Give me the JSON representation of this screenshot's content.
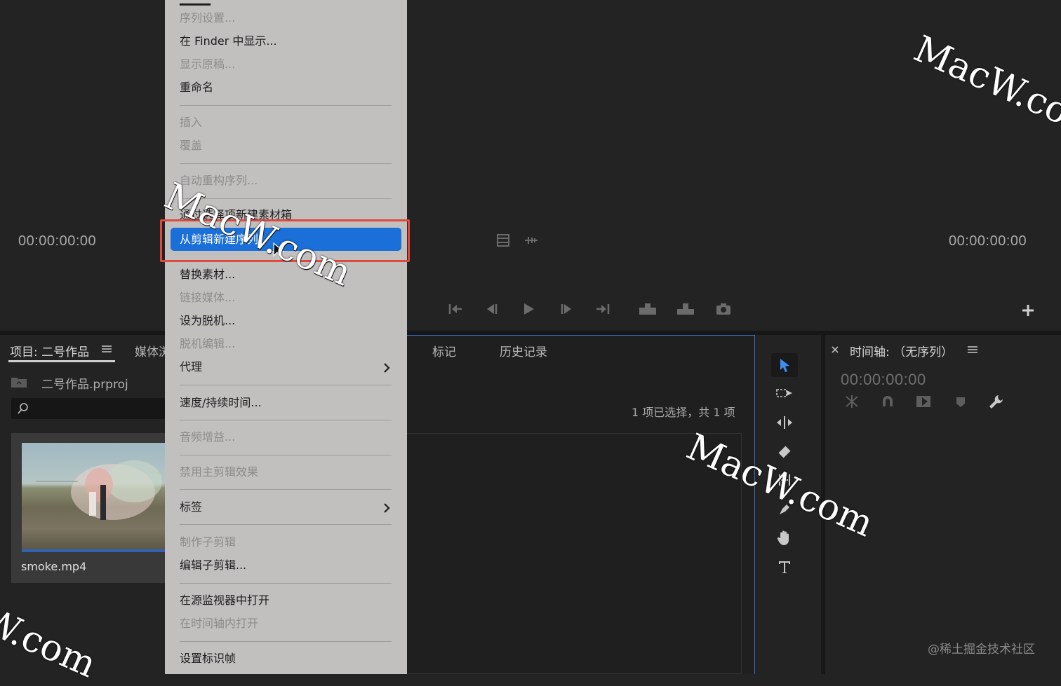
{
  "monitor": {
    "source_timecode": "00:00:00:00",
    "program_timecode": "00:00:00:00"
  },
  "project_panel": {
    "tab_project": "项目: 二号作品",
    "tab_media": "媒体浏",
    "file_name": "二号作品.prproj",
    "clip_name": "smoke.mp4"
  },
  "mid_panel": {
    "tab_markers": "标记",
    "tab_history": "历史记录",
    "selection_status": "1 项已选择，共 1 项"
  },
  "timeline": {
    "title": "时间轴: （无序列）",
    "timecode": "00:00:00:00"
  },
  "context_menu": {
    "items": [
      {
        "label": "序列设置...",
        "enabled": false
      },
      {
        "label": "在 Finder 中显示...",
        "enabled": true
      },
      {
        "label": "显示原稿...",
        "enabled": false
      },
      {
        "label": "重命名",
        "enabled": true
      },
      {
        "label": "插入",
        "enabled": false
      },
      {
        "label": "覆盖",
        "enabled": false
      },
      {
        "label": "自动重构序列...",
        "enabled": false
      },
      {
        "label": "通过选择项新建素材箱",
        "enabled": true
      },
      {
        "label": "从剪辑新建序列",
        "enabled": true,
        "highlighted": true
      },
      {
        "label": "替换素材...",
        "enabled": true
      },
      {
        "label": "链接媒体...",
        "enabled": false
      },
      {
        "label": "设为脱机...",
        "enabled": true
      },
      {
        "label": "脱机编辑...",
        "enabled": false
      },
      {
        "label": "代理",
        "enabled": true,
        "submenu": true
      },
      {
        "label": "速度/持续时间...",
        "enabled": true
      },
      {
        "label": "音频增益...",
        "enabled": false
      },
      {
        "label": "禁用主剪辑效果",
        "enabled": false
      },
      {
        "label": "标签",
        "enabled": true,
        "submenu": true
      },
      {
        "label": "制作子剪辑",
        "enabled": false
      },
      {
        "label": "编辑子剪辑...",
        "enabled": true
      },
      {
        "label": "在源监视器中打开",
        "enabled": true
      },
      {
        "label": "在时间轴内打开",
        "enabled": false
      },
      {
        "label": "设置标识帧",
        "enabled": true
      }
    ]
  },
  "watermark": "MacW.com",
  "credit": "@稀土掘金技术社区",
  "colors": {
    "highlight": "#1b6fd8",
    "annotation_box": "#e0493e",
    "panel_bg": "#232323",
    "menu_bg": "#c2bfbf"
  }
}
